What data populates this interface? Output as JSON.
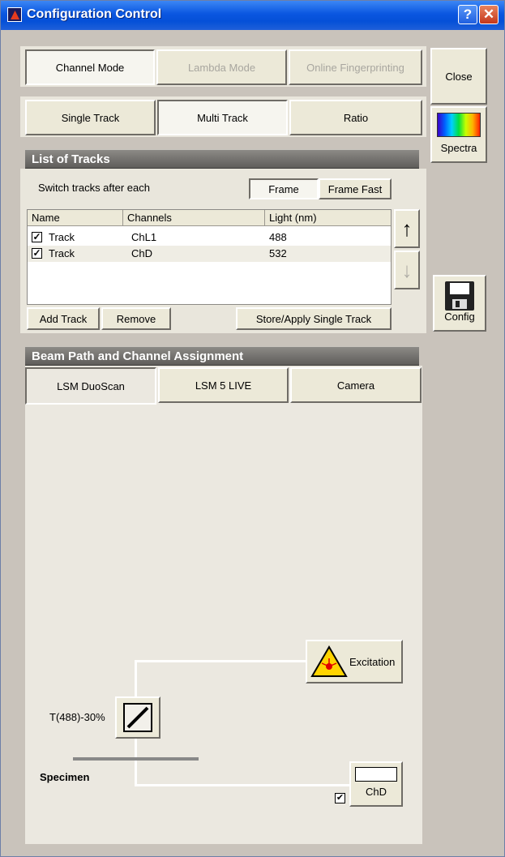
{
  "window": {
    "title": "Configuration Control",
    "help_label": "?",
    "close_label": "✕"
  },
  "mode_tabs": {
    "channel": "Channel Mode",
    "lambda": "Lambda Mode",
    "fingerprint": "Online Fingerprinting"
  },
  "track_tabs": {
    "single": "Single Track",
    "multi": "Multi Track",
    "ratio": "Ratio"
  },
  "side": {
    "close": "Close",
    "spectra": "Spectra",
    "config": "Config"
  },
  "tracks": {
    "header": "List of Tracks",
    "switch_label": "Switch tracks after each",
    "frame": "Frame",
    "frame_fast": "Frame Fast",
    "columns": [
      "Name",
      "Channels",
      "Light (nm)"
    ],
    "rows": [
      {
        "checked": true,
        "name": "Track",
        "channels": "ChL1",
        "light": "488"
      },
      {
        "checked": true,
        "name": "Track",
        "channels": "ChD",
        "light": "532"
      }
    ],
    "up_arrow": "↑",
    "down_arrow": "↓",
    "add": "Add Track",
    "remove": "Remove",
    "store": "Store/Apply Single Track"
  },
  "beam": {
    "header": "Beam Path and Channel Assignment",
    "tabs": [
      "LSM DuoScan",
      "LSM 5 LIVE",
      "Camera"
    ],
    "excitation": "Excitation",
    "beamsplitter": "T(488)-30%",
    "specimen": "Specimen",
    "channel": "ChD",
    "check": "✔"
  }
}
